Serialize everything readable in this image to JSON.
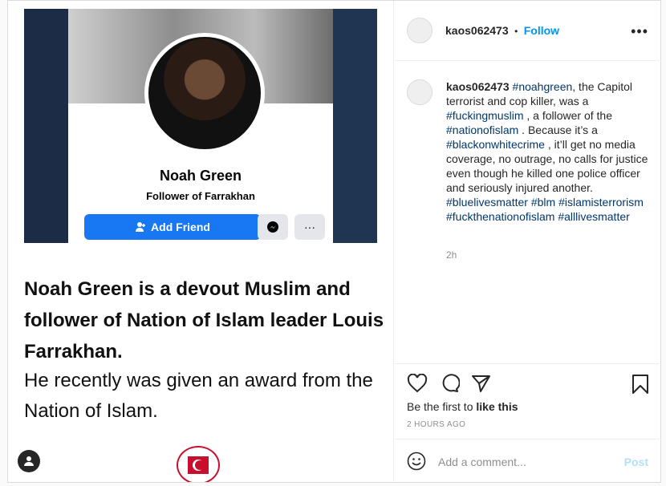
{
  "media": {
    "fb_name": "Noah Green",
    "fb_subtitle": "Follower of Farrakhan",
    "add_friend_label": "Add Friend",
    "more_label": "···",
    "caption_bold": "Noah Green is a devout Muslim and follower of Nation of Islam leader Louis Farrakhan.",
    "caption_regular": "He recently was given an award from the Nation of Islam."
  },
  "header": {
    "username": "kaos062473",
    "separator": "•",
    "follow_label": "Follow",
    "more_label": "•••"
  },
  "comment": {
    "username": "kaos062473",
    "parts": [
      {
        "t": " ",
        "tag": false
      },
      {
        "t": "#noahgreen",
        "tag": true
      },
      {
        "t": ", the Capitol terrorist and cop killer, was a ",
        "tag": false
      },
      {
        "t": "#fuckingmuslim",
        "tag": true
      },
      {
        "t": " , a follower of the ",
        "tag": false
      },
      {
        "t": "#nationofislam",
        "tag": true
      },
      {
        "t": " . Because it’s a ",
        "tag": false
      },
      {
        "t": "#blackonwhitecrime",
        "tag": true
      },
      {
        "t": " , it’ll get no media coverage, no outrage, no calls for justice even though he killed one police officer and seriously injured another. ",
        "tag": false
      },
      {
        "t": "#bluelivesmatter",
        "tag": true
      },
      {
        "t": " ",
        "tag": false
      },
      {
        "t": "#blm",
        "tag": true
      },
      {
        "t": " ",
        "tag": false
      },
      {
        "t": "#islamisterrorism",
        "tag": true
      },
      {
        "t": " ",
        "tag": false
      },
      {
        "t": "#fuckthenationofislam",
        "tag": true
      },
      {
        "t": " ",
        "tag": false
      },
      {
        "t": "#alllivesmatter",
        "tag": true
      }
    ],
    "time": "2h"
  },
  "actions": {
    "likes_prefix": "Be the first to ",
    "likes_link": "like this",
    "timestamp": "2 HOURS AGO"
  },
  "add_comment": {
    "placeholder": "Add a comment...",
    "post_label": "Post"
  }
}
